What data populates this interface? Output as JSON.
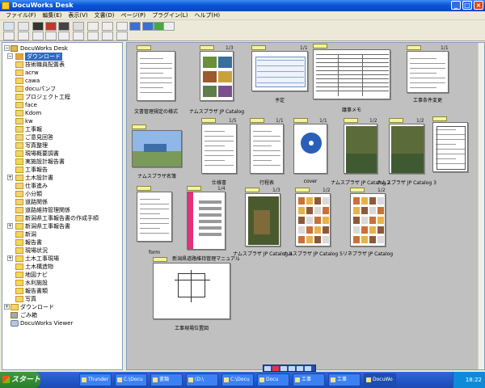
{
  "window": {
    "title": "DocuWorks Desk"
  },
  "menu": [
    "ファイル(F)",
    "編集(E)",
    "表示(V)",
    "文書(D)",
    "ページ(P)",
    "プラグイン(L)",
    "ヘルプ(H)"
  ],
  "tree": {
    "root": "DocuWorks Desk",
    "selected": "ダウンロード",
    "items": [
      "ダウンロード",
      "技術職員配置表",
      "acrw",
      "cawa",
      "docuパンフ",
      "プロジェクト工程",
      "face",
      "Kdom",
      "kw",
      "工事報",
      "ご意見回答",
      "写真整理",
      "現場概要調書",
      "実施設計報告書",
      "工事報告",
      "土木設計書",
      "仕事進み",
      "小分類",
      "道路関係",
      "道路維持管理関係",
      "新潟県工事報告書の作成手順",
      "新潟県工事報告書",
      "新潟",
      "報告書",
      "現場状況",
      "土木工事現場",
      "土木構造物",
      "地図ナビ",
      "水利施設",
      "報告書類",
      "写真"
    ],
    "extra": [
      "ダウンロード",
      "ごみ箱",
      "DocuWorks Viewer"
    ]
  },
  "thumbs": [
    {
      "caption": "文書管理規定の様式",
      "pages": ""
    },
    {
      "caption": "ナムスプラザ JP Catalog",
      "pages": "1/3"
    },
    {
      "caption": "予定",
      "pages": "1/1"
    },
    {
      "caption": "議事メモ",
      "pages": ""
    },
    {
      "caption": "工事条件変更",
      "pages": "1/1"
    },
    {
      "caption": "ナムスプラザ名簿",
      "pages": ""
    },
    {
      "caption": "仕様書",
      "pages": "1/5"
    },
    {
      "caption": "行程表",
      "pages": "1/1"
    },
    {
      "caption": "cover",
      "pages": "1/1"
    },
    {
      "caption": "ナムスプラザ JP Catalog 2",
      "pages": "1/2"
    },
    {
      "caption": "ナムスプラザ JP Catalog 3",
      "pages": "1/2"
    },
    {
      "caption": "",
      "pages": ""
    },
    {
      "caption": "form",
      "pages": ""
    },
    {
      "caption": "新潟県道路維持管理マニュアル",
      "pages": "1/4"
    },
    {
      "caption": "ナムスプラザ JP Catalog 4",
      "pages": "1/3"
    },
    {
      "caption": "ナムスプラザ JP Catalog 5",
      "pages": "1/2"
    },
    {
      "caption": "リネプラザ JP Catalog",
      "pages": "1/2"
    },
    {
      "caption": "工事現場位置図",
      "pages": ""
    }
  ],
  "taskbar": {
    "start": "スタート",
    "buttons": [
      "Thunder",
      "C:\\Docu",
      "書類",
      "(D:\\",
      "C:\\Docu",
      "Docu",
      "工事",
      "工事",
      "DocuWo"
    ],
    "clock": "18:22"
  },
  "colors": {
    "titlebar": "#0a55d6",
    "selection": "#316ac5",
    "panel": "#c0c0c0"
  }
}
